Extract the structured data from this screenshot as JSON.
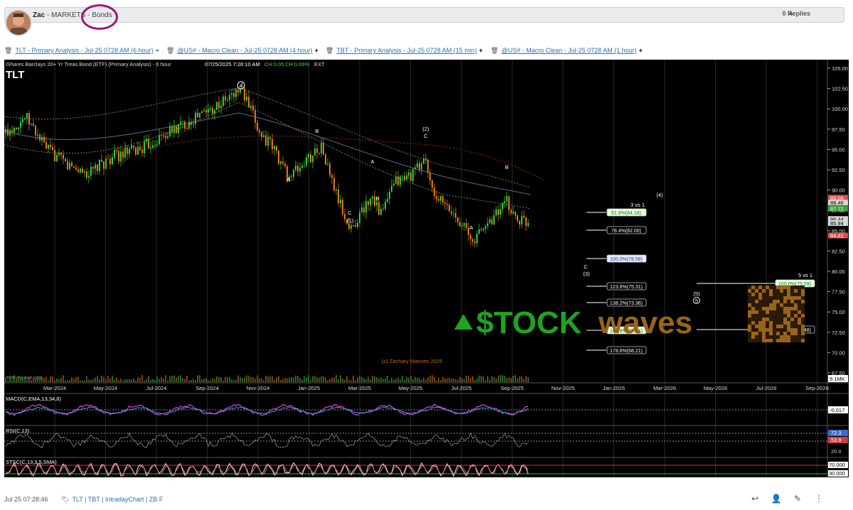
{
  "post": {
    "author": "Zac",
    "breadcrumb_sep1": " - ",
    "section": "MARKETS",
    "breadcrumb_sep2": " - ",
    "subsection": "Bonds",
    "replies": "0 Replies"
  },
  "links": [
    {
      "label": "TLT - Primary Analysis - Jul-25 0728 AM (6 hour)",
      "sign": "−"
    },
    {
      "label": "@US# - Macro Clean - Jul-25 0728 AM (4 hour)",
      "sign": "+"
    },
    {
      "label": "TBT - Primary Analysis - Jul-25 0728 AM (15 min)",
      "sign": "+"
    },
    {
      "label": "@US# - Macro Clean - Jul-25 0728 AM (1 hour)",
      "sign": "+"
    }
  ],
  "chart": {
    "title": "iShares Barclays 20+ Yr Treas.Bond (ETF) (Primary Analysis) - 6 hour",
    "symbol": "TLT",
    "datetime": "07/25/2025 7:28:10 AM",
    "change": "CH:0.05",
    "change_pct": "CH:0.06%",
    "ext": "EXT",
    "copyright": "(c) Zachary Mannes 2025",
    "watermark_left": "motivewave.com",
    "logo_prefix": "$TOCK",
    "logo_suffix": "waves",
    "volume_label": "9.1MK",
    "price_ticks": [
      "105.00",
      "102.50",
      "100.00",
      "97.50",
      "95.00",
      "92.50",
      "90.00",
      "87.50",
      "85.00",
      "82.50",
      "80.00",
      "77.50",
      "75.00",
      "72.50",
      "70.00",
      "67.50"
    ],
    "price_tags": [
      {
        "text": "89.06",
        "color": "#e05050"
      },
      {
        "text": "88.46",
        "color": "#d8d8d8"
      },
      {
        "text": "87.72",
        "color": "#3ca33c"
      },
      {
        "text": "86.44",
        "color": "#d8d8d8"
      },
      {
        "text": "85.94",
        "color": "#d8d8d8"
      },
      {
        "text": "84.41",
        "color": "#e05050"
      }
    ],
    "x_ticks": [
      "Mar-2024",
      "May-2024",
      "Jul-2024",
      "Sep-2024",
      "Nov-2024",
      "Jan-2025",
      "Mar-2025",
      "May-2025",
      "Jul-2025",
      "Sep-2025",
      "Nov-2025",
      "Jan-2026",
      "Mar-2026",
      "May-2026",
      "Jul-2026",
      "Sep-2026"
    ],
    "wave_labels": [
      {
        "text": "4",
        "circled": true
      },
      {
        "text": "B"
      },
      {
        "text": "A"
      },
      {
        "text": "C"
      },
      {
        "text": "(1)"
      },
      {
        "text": "A"
      },
      {
        "text": "B"
      },
      {
        "text": "(2)"
      },
      {
        "text": "C"
      },
      {
        "text": "B"
      },
      {
        "text": "A"
      },
      {
        "text": "(4)"
      },
      {
        "text": "C"
      },
      {
        "text": "(3)"
      },
      {
        "text": "(5)"
      },
      {
        "text": "5",
        "circled": true
      }
    ],
    "fib_header_left": "3 vs 1",
    "fib_header_right": "5 vs 1",
    "fibs_left": [
      {
        "text": "61.8%(84.18)",
        "style": "green"
      },
      {
        "text": "78.4%(82.00)",
        "style": "plain"
      },
      {
        "text": "100.0%(78.58)",
        "style": "blue"
      },
      {
        "text": "123.6%(75.31)",
        "style": "plain"
      },
      {
        "text": "138.2%(73.36)",
        "style": "plain"
      },
      {
        "text": "161.8%(70.31)",
        "style": "green"
      },
      {
        "text": "178.6%(68.21)",
        "style": "plain"
      }
    ],
    "fibs_right": [
      {
        "text": "100.0%(75.59)",
        "style": "green"
      },
      {
        "text": "123.6%(70.48)",
        "style": "plain"
      }
    ],
    "macd": {
      "label": "MACD(C,EMA,13,34,8)",
      "value": "-0.017"
    },
    "rsi": {
      "label": "RSI(C,13)",
      "high": "72.3",
      "low": "53.9",
      "level": "20.0"
    },
    "stoch": {
      "label": "STSC(C,13,3,5,SMA)",
      "high": "70.000",
      "low": "30.000"
    }
  },
  "footer": {
    "timestamp": "Jul 25 07:28:46",
    "tags": [
      "TLT",
      "TBT",
      "IntradayChart",
      "ZB.F"
    ],
    "tag_sep": " | "
  }
}
